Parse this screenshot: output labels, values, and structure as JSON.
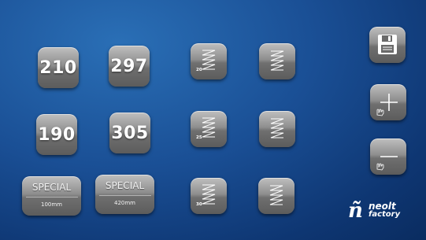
{
  "size_buttons": [
    {
      "label": "210"
    },
    {
      "label": "297"
    },
    {
      "label": "190"
    },
    {
      "label": "305"
    }
  ],
  "special_buttons": [
    {
      "title": "SPECIAL",
      "sub": "100mm"
    },
    {
      "title": "SPECIAL",
      "sub": "420mm"
    }
  ],
  "stitch_buttons": [
    {
      "number": "20",
      "icon": "zigzag-stitch-icon"
    },
    {
      "number": "",
      "icon": "zigzag-stitch-icon"
    },
    {
      "number": "25",
      "icon": "zigzag-stitch-icon"
    },
    {
      "number": "",
      "icon": "zigzag-stitch-icon"
    },
    {
      "number": "30",
      "icon": "zigzag-stitch-icon"
    },
    {
      "number": "",
      "icon": "zigzag-stitch-icon"
    }
  ],
  "side_buttons": [
    {
      "icon": "save-icon"
    },
    {
      "icon": "plus-icon"
    },
    {
      "icon": "minus-icon"
    }
  ],
  "logo": {
    "word1": "neolt",
    "word2": "factory"
  },
  "colors": {
    "background": "#1a4f95",
    "button": "#8e8e8e"
  }
}
